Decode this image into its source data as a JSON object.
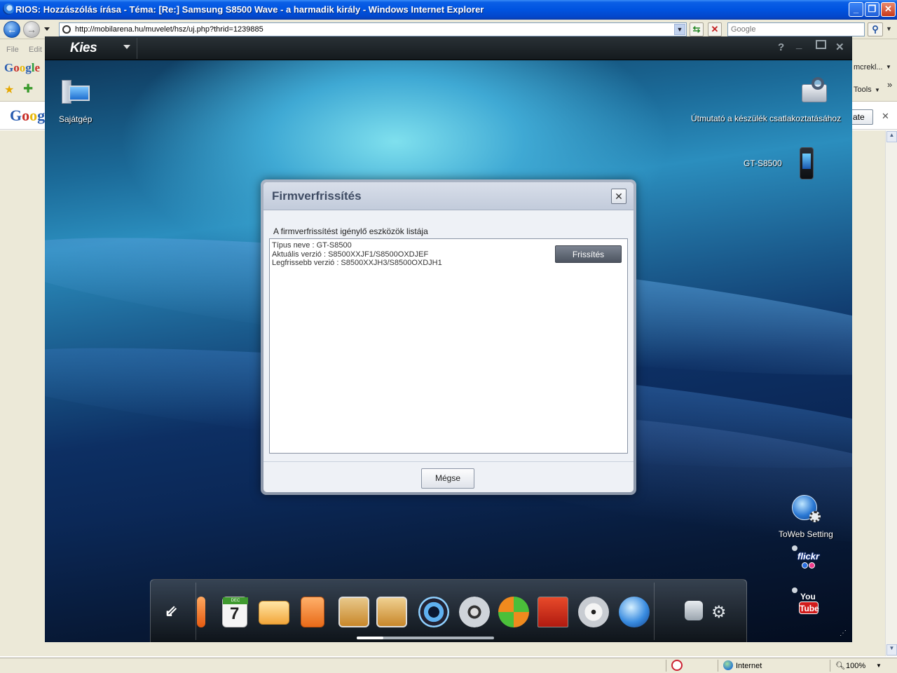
{
  "browser": {
    "title": "RIOS: Hozzászólás írása - Téma: [Re:] Samsung S8500 Wave - a harmadik király - Windows Internet Explorer",
    "url": "http://mobilarena.hu/muvelet/hsz/uj.php?thrid=1239885",
    "search_placeholder": "Google",
    "menu": [
      "File",
      "Edit"
    ],
    "google_toolbar_logo": "Google",
    "google_toolbar_right": "mcrekl...",
    "tools_label": "Tools",
    "more_chevron": "»",
    "infobar_logo": "Goog",
    "infobar_button": "ate",
    "status": {
      "zone": "Internet",
      "zoom": "100%"
    }
  },
  "kies": {
    "app_name": "Kies",
    "desktop": {
      "my_computer": "Sajátgép",
      "guide": "Útmutató a készülék csatlakoztatásához",
      "device": "GT-S8500",
      "toweb": "ToWeb Setting",
      "flickr": "flickr",
      "youtube_top": "You",
      "youtube_bottom": "Tube"
    },
    "dialog": {
      "title": "Firmverfrissítés",
      "subtitle": "A firmverfrissítést igénylő eszközök listája",
      "model_line": "Típus neve : GT-S8500",
      "current_line": "Aktuális verzió : S8500XXJF1/S8500OXDJEF",
      "latest_line": "Legfrissebb verzió : S8500XXJH3/S8500OXDJH1",
      "update_button": "Frissítés",
      "cancel_button": "Mégse",
      "close_glyph": "✕"
    },
    "dock": {
      "calendar_month": "DEC",
      "calendar_day": "7",
      "icons": [
        "import-export-icon",
        "calendar-icon",
        "mail-icon",
        "memo-icon",
        "photo-icon",
        "photo-edit-icon",
        "music-icon",
        "video-icon",
        "sync-icon",
        "backup-icon",
        "disc-icon",
        "web-icon",
        "device-transfer-icon",
        "settings-icon"
      ]
    }
  }
}
